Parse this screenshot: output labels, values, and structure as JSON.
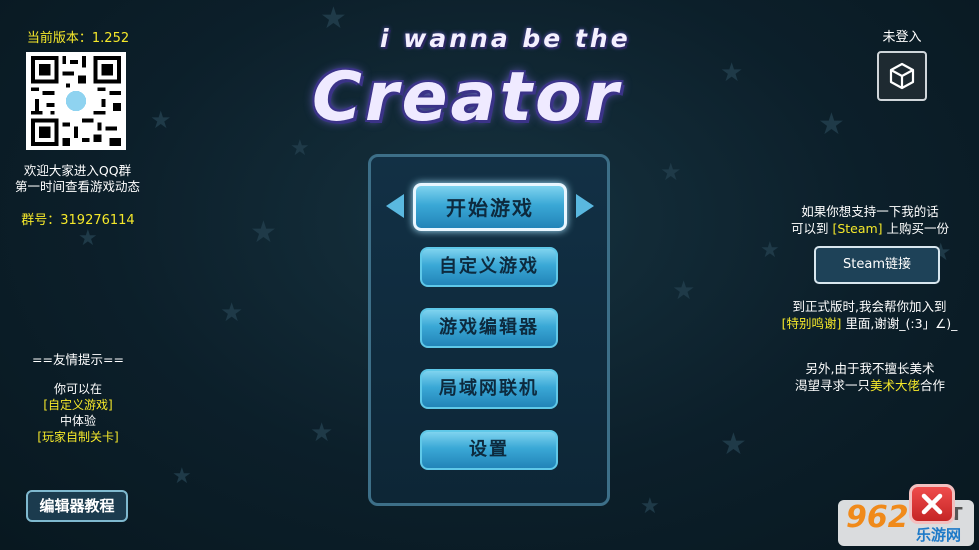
{
  "left_panel": {
    "version": "当前版本：1.252",
    "qq_line1": "欢迎大家进入QQ群",
    "qq_line2": "第一时间查看游戏动态",
    "group_number": "群号：319276114",
    "tip_header": "==友情提示==",
    "tip_line1": "你可以在",
    "tip_highlight1": "[自定义游戏]",
    "tip_line2": "中体验",
    "tip_highlight2": "[玩家自制关卡]",
    "editor_tutorial_label": "编辑器教程"
  },
  "title": {
    "small": "i wanna be the",
    "big": "Creator"
  },
  "login": {
    "status": "未登入",
    "icon": "unity-icon"
  },
  "menu": {
    "items": [
      {
        "label": "开始游戏",
        "selected": true
      },
      {
        "label": "自定义游戏",
        "selected": false
      },
      {
        "label": "游戏编辑器",
        "selected": false
      },
      {
        "label": "局域网联机",
        "selected": false
      },
      {
        "label": "设置",
        "selected": false
      }
    ]
  },
  "right_panel": {
    "support_line1": "如果你想支持一下我的话",
    "support_line2_prefix": "可以到 ",
    "support_line2_highlight": "[Steam]",
    "support_line2_suffix": " 上购买一份",
    "steam_button": "Steam链接",
    "thanks_line1": "到正式版时,我会帮你加入到",
    "thanks_highlight": "[特别鸣谢]",
    "thanks_line2_suffix": " 里面,谢谢_(:3」∠)_",
    "artist_line1": "另外,由于我不擅长美术",
    "artist_line2_prefix": "渴望寻求一只",
    "artist_highlight": "美术大佬",
    "artist_line2_suffix": "合作"
  },
  "watermark": {
    "num": "962",
    "net": ".NET",
    "cn": "乐游网"
  },
  "colors": {
    "highlight_yellow": "#f5e82a",
    "button_blue": "#3aa8d6",
    "close_red": "#e03a3a"
  }
}
